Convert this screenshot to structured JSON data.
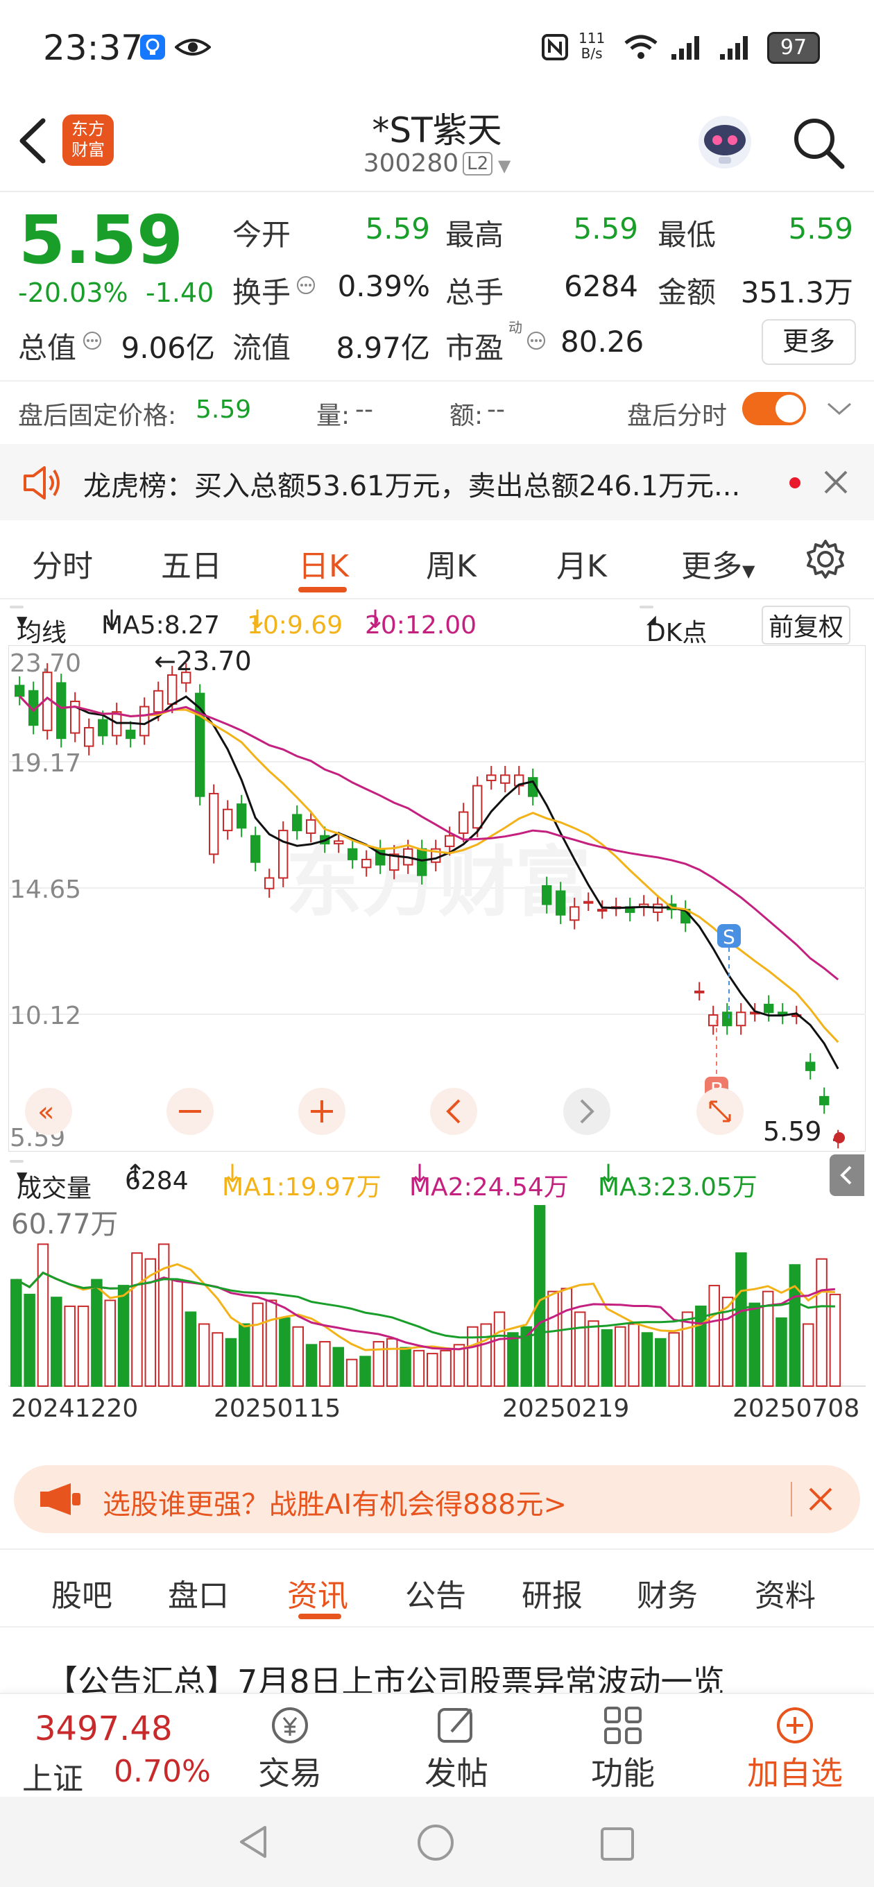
{
  "status": {
    "time": "23:37",
    "net_speed": "111\nB/s",
    "battery": "97"
  },
  "header": {
    "title": "*ST紫天",
    "code": "300280",
    "level": "L2",
    "logo": "东方\n财富"
  },
  "quote": {
    "price": "5.59",
    "change_pct": "-20.03%",
    "change": "-1.40",
    "rows": [
      [
        {
          "label": "今开",
          "value": "5.59"
        },
        {
          "label": "最高",
          "value": "5.59"
        },
        {
          "label": "最低",
          "value": "5.59"
        }
      ],
      [
        {
          "label": "换手",
          "value": "0.39%"
        },
        {
          "label": "总手",
          "value": "6284"
        },
        {
          "label": "金额",
          "value": "351.3万"
        }
      ],
      [
        {
          "label": "总值",
          "value": "9.06亿"
        },
        {
          "label": "流值",
          "value": "8.97亿"
        },
        {
          "label": "市盈",
          "value": "80.26"
        }
      ]
    ],
    "more": "更多",
    "pe_sup": "动"
  },
  "after_hours": {
    "label": "盘后固定价格:",
    "price": "5.59",
    "vol_label": "量:",
    "vol": "--",
    "amt_label": "额:",
    "amt": "--",
    "timeshare": "盘后分时"
  },
  "notice": {
    "text": "龙虎榜：买入总额53.61万元，卖出总额246.1万元..."
  },
  "chart_tabs": [
    "分时",
    "五日",
    "日K",
    "周K",
    "月K",
    "更多"
  ],
  "ma_bar": {
    "type": "均线",
    "ma5": "MA5:8.27",
    "ma10": "10:9.69",
    "ma20": "20:12.00",
    "dk": "DK点",
    "adj": "前复权"
  },
  "kline": {
    "y_labels": [
      "23.70",
      "19.17",
      "14.65",
      "10.12",
      "5.59"
    ],
    "high_mark": "←23.70",
    "last_mark": "5.59",
    "sell_mark": "S",
    "buy_mark": "B",
    "watermark": "东方财富"
  },
  "vol_bar": {
    "type": "成交量",
    "vol": "6284",
    "ma1": "MA1:19.97万",
    "ma2": "MA2:24.54万",
    "ma3": "MA3:23.05万",
    "max": "60.77万"
  },
  "dates": [
    "20241220",
    "20250115",
    "20250219",
    "20250708"
  ],
  "promo": {
    "text": "选股谁更强？战胜AI有机会得888元>"
  },
  "info_tabs": [
    "股吧",
    "盘口",
    "资讯",
    "公告",
    "研报",
    "财务",
    "资料"
  ],
  "news": {
    "headline": "【公告汇总】7月8日上市公司股票异常波动一览"
  },
  "bottom": {
    "index_value": "3497.48",
    "index_name": "上证",
    "index_pct": "0.70%",
    "items": [
      "交易",
      "发帖",
      "功能",
      "加自选"
    ]
  },
  "colors": {
    "up": "#c8292a",
    "down": "#1a9e2a",
    "accent": "#e8541e",
    "ma5": "#111111",
    "ma10": "#f2b218",
    "ma20": "#c4207f"
  },
  "chart_data": {
    "type": "candlestick",
    "series": [
      {
        "values": [
          [
            22.8,
            22.4
          ],
          [
            22.6,
            21.3
          ],
          [
            21.1,
            23.3
          ],
          [
            22.9,
            20.8
          ],
          [
            21.0,
            22.2
          ],
          [
            20.5,
            21.2
          ],
          [
            21.5,
            20.9
          ],
          [
            20.9,
            21.8
          ],
          [
            21.1,
            20.8
          ],
          [
            20.9,
            22.0
          ],
          [
            21.8,
            22.6
          ],
          [
            22.1,
            23.2
          ],
          [
            22.9,
            23.3
          ],
          [
            22.5,
            18.6
          ],
          [
            16.4,
            18.7
          ],
          [
            17.3,
            18.1
          ],
          [
            18.3,
            17.4
          ],
          [
            17.1,
            16.1
          ],
          [
            15.1,
            15.5
          ],
          [
            15.5,
            17.3
          ],
          [
            17.9,
            17.3
          ],
          [
            17.2,
            17.7
          ],
          [
            17.1,
            16.8
          ],
          [
            16.8,
            16.9
          ],
          [
            16.6,
            16.2
          ],
          [
            15.9,
            16.2
          ],
          [
            16.6,
            16.0
          ],
          [
            15.8,
            16.4
          ],
          [
            16.0,
            16.6
          ],
          [
            16.6,
            15.6
          ],
          [
            16.1,
            16.6
          ],
          [
            16.7,
            17.1
          ],
          [
            17.2,
            18.0
          ],
          [
            17.4,
            19.0
          ],
          [
            19.2,
            19.4
          ],
          [
            19.1,
            19.4
          ],
          [
            19.0,
            19.4
          ],
          [
            19.3,
            18.6
          ],
          [
            15.2,
            14.5
          ],
          [
            15.0,
            14.1
          ],
          [
            13.9,
            14.4
          ],
          [
            14.6,
            14.6
          ],
          [
            14.3,
            14.3
          ],
          [
            14.4,
            14.4
          ],
          [
            14.4,
            14.2
          ],
          [
            14.4,
            14.5
          ],
          [
            14.2,
            14.5
          ],
          [
            14.5,
            14.3
          ],
          [
            14.3,
            13.8
          ],
          [
            11.2,
            11.2
          ],
          [
            9.9,
            10.3
          ],
          [
            10.4,
            9.9
          ],
          [
            9.9,
            10.4
          ],
          [
            10.4,
            10.4
          ],
          [
            10.7,
            10.4
          ],
          [
            10.4,
            10.3
          ],
          [
            10.3,
            10.3
          ],
          [
            8.5,
            8.2
          ],
          [
            7.2,
            6.9
          ],
          [
            5.59,
            5.59
          ]
        ]
      }
    ],
    "volume_values": [
      36,
      31,
      48,
      30,
      27,
      27,
      36,
      29,
      34,
      45,
      43,
      48,
      36,
      25,
      21,
      18,
      16,
      21,
      28,
      29,
      23,
      20,
      14,
      15,
      13,
      9,
      10,
      15,
      16,
      13,
      12,
      11,
      12,
      14,
      20,
      21,
      25,
      18,
      20,
      61,
      32,
      33,
      25,
      22,
      19,
      20,
      21,
      18,
      16,
      18,
      25,
      27,
      34,
      30,
      45,
      28,
      32,
      23,
      41,
      21,
      43,
      31
    ],
    "ma_close": {
      "ma5": "8.27",
      "ma10": "9.69",
      "ma20": "12.00"
    },
    "ylim": [
      5.59,
      23.7
    ],
    "volume_max": "60.77万",
    "x_ticks": [
      "20241220",
      "20250115",
      "20250219",
      "20250708"
    ]
  }
}
